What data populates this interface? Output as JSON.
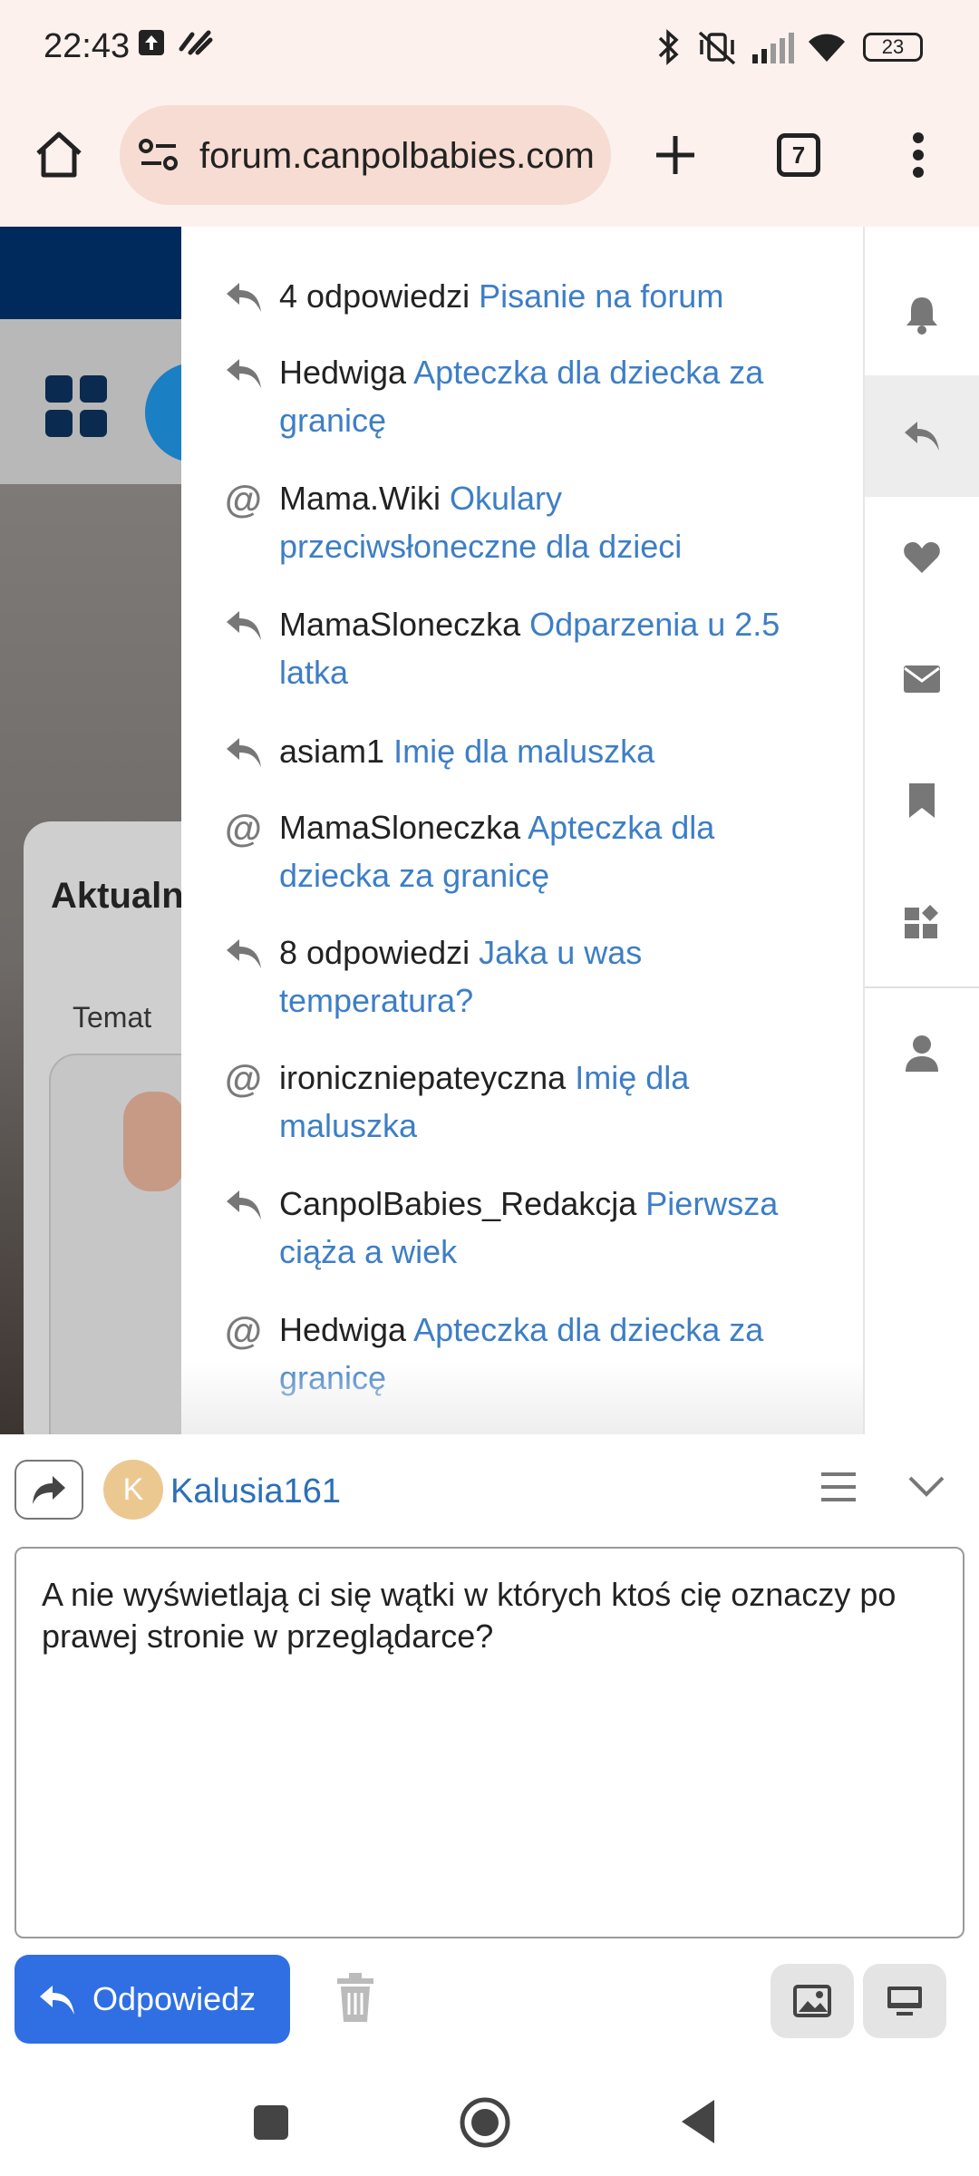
{
  "status_bar": {
    "time": "22:43",
    "battery": "23"
  },
  "browser": {
    "url": "forum.canpolbabies.com",
    "tab_count": "7"
  },
  "background_page": {
    "card_title": "Aktualn",
    "card_subtitle": "Temat"
  },
  "notifications": [
    {
      "type": "reply",
      "icon": "reply-icon",
      "user": "4 odpowiedzi",
      "topic": "Pisanie na forum"
    },
    {
      "type": "reply",
      "icon": "reply-icon",
      "user": "Hedwiga",
      "topic": "Apteczka dla dziecka za granicę"
    },
    {
      "type": "mention",
      "icon": "at-icon",
      "user": "Mama.Wiki",
      "topic": "Okulary przeciwsłoneczne dla dzieci"
    },
    {
      "type": "reply",
      "icon": "reply-icon",
      "user": "MamaSloneczka",
      "topic": "Odparzenia u 2.5 latka"
    },
    {
      "type": "reply",
      "icon": "reply-icon",
      "user": "asiam1",
      "topic": "Imię dla maluszka"
    },
    {
      "type": "mention",
      "icon": "at-icon",
      "user": "MamaSloneczka",
      "topic": "Apteczka dla dziecka za granicę"
    },
    {
      "type": "reply",
      "icon": "reply-icon",
      "user": "8 odpowiedzi",
      "topic": "Jaka u was temperatura?"
    },
    {
      "type": "mention",
      "icon": "at-icon",
      "user": "ironiczniepateyczna",
      "topic": "Imię dla maluszka"
    },
    {
      "type": "reply",
      "icon": "reply-icon",
      "user": "CanpolBabies_Redakcja",
      "topic": "Pierwsza ciąża a wiek"
    },
    {
      "type": "mention",
      "icon": "at-icon",
      "user": "Hedwiga",
      "topic": "Apteczka dla dziecka za granicę"
    }
  ],
  "rail": [
    "bell-icon",
    "reply-icon",
    "heart-icon",
    "envelope-icon",
    "bookmark-icon",
    "widgets-icon",
    "user-icon"
  ],
  "composer": {
    "avatar_letter": "K",
    "username": "Kalusia161",
    "text": "A nie wyświetlają ci się wątki w których ktoś cię oznaczy po prawej stronie w przeglądarce?",
    "reply_label": "Odpowiedz"
  },
  "colors": {
    "link": "#3d7ec6",
    "reply_button": "#2f6fe3",
    "browser_bar": "#fdf1ee",
    "url_pill": "#f6dcd2"
  }
}
